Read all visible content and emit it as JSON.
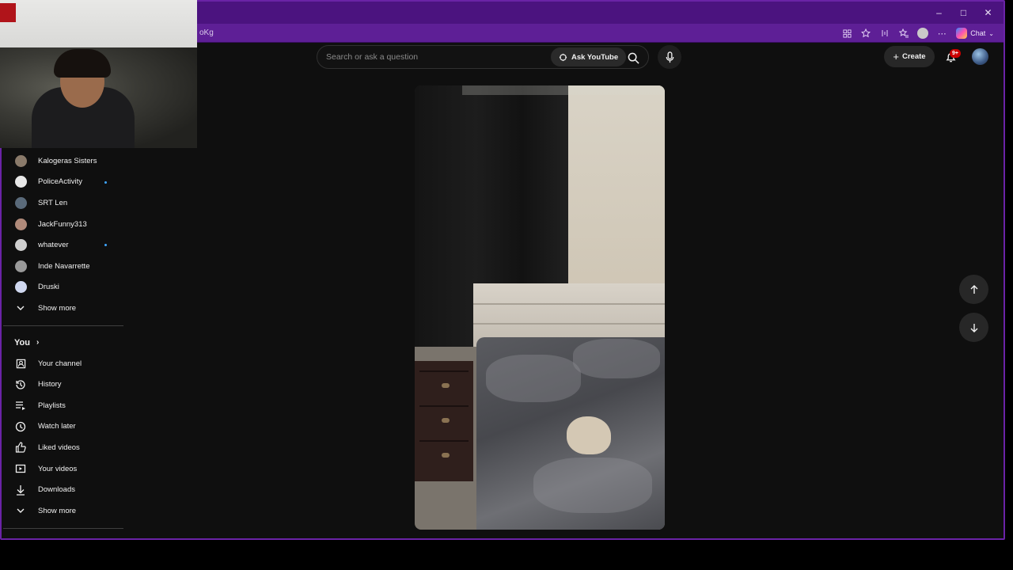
{
  "browser": {
    "url_fragment": "oKg",
    "window_controls": {
      "minimize": "–",
      "maximize": "□",
      "close": "✕"
    },
    "chat_label": "Chat"
  },
  "header": {
    "search_placeholder": "Search or ask a question",
    "ask_label": "Ask YouTube",
    "create_label": "Create",
    "notification_badge": "9+"
  },
  "sidebar": {
    "subscriptions": [
      {
        "name": "Kalogeras Sisters",
        "new": false,
        "color": "#8a7a6a"
      },
      {
        "name": "PoliceActivity",
        "new": true,
        "color": "#e8e8e8"
      },
      {
        "name": "SRT Len",
        "new": false,
        "color": "#5a6a7a"
      },
      {
        "name": "JackFunny313",
        "new": false,
        "color": "#b08a7a"
      },
      {
        "name": "whatever",
        "new": true,
        "color": "#cfcfcf"
      },
      {
        "name": "Inde Navarrette",
        "new": false,
        "color": "#9a9a9a"
      },
      {
        "name": "Druski",
        "new": false,
        "color": "#d0d8f0"
      }
    ],
    "show_more_1": "Show more",
    "you_label": "You",
    "you_items": [
      {
        "label": "Your channel",
        "icon": "channel-icon"
      },
      {
        "label": "History",
        "icon": "history-icon"
      },
      {
        "label": "Playlists",
        "icon": "playlists-icon"
      },
      {
        "label": "Watch later",
        "icon": "watch-later-icon"
      },
      {
        "label": "Liked videos",
        "icon": "like-icon"
      },
      {
        "label": "Your videos",
        "icon": "your-videos-icon"
      },
      {
        "label": "Downloads",
        "icon": "download-icon"
      }
    ],
    "show_more_2": "Show more"
  },
  "colors": {
    "frame_purple": "#6a23a6",
    "titlebar": "#4b137f",
    "page_bg": "#0f0f0f",
    "badge_red": "#cc0000",
    "new_dot": "#3ea6ff"
  }
}
